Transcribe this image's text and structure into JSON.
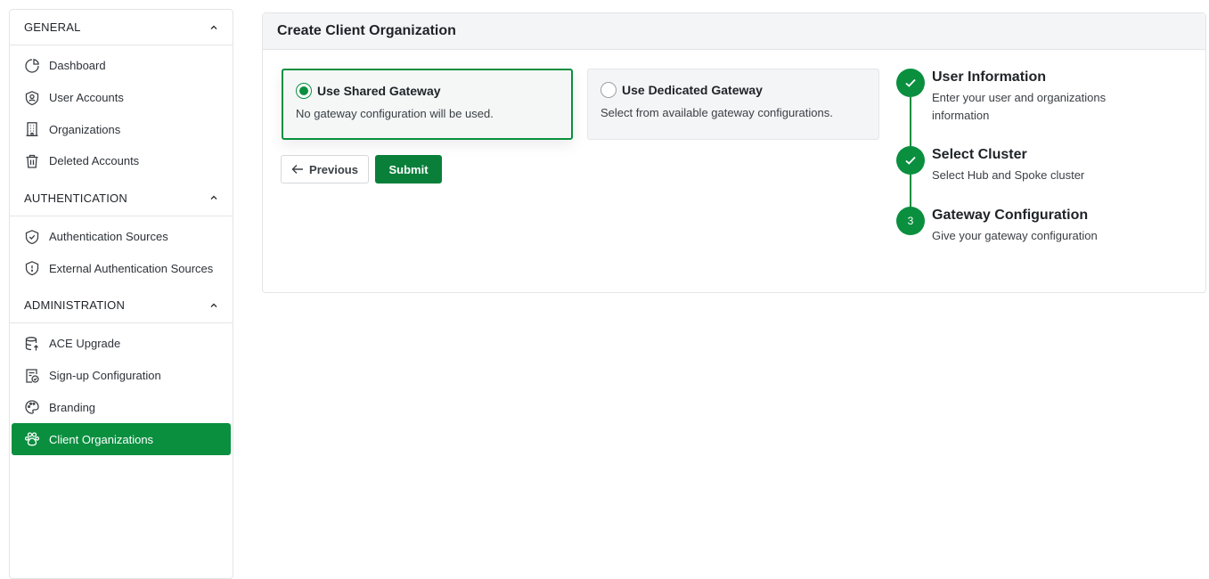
{
  "sidebar": {
    "sections": [
      {
        "title": "GENERAL",
        "items": [
          {
            "label": "Dashboard",
            "icon": "chart-pie-icon"
          },
          {
            "label": "User Accounts",
            "icon": "user-circle-icon"
          },
          {
            "label": "Organizations",
            "icon": "building-icon"
          },
          {
            "label": "Deleted Accounts",
            "icon": "trash-icon"
          }
        ]
      },
      {
        "title": "AUTHENTICATION",
        "items": [
          {
            "label": "Authentication Sources",
            "icon": "shield-check-icon"
          },
          {
            "label": "External Authentication Sources",
            "icon": "shield-alert-icon"
          }
        ]
      },
      {
        "title": "ADMINISTRATION",
        "items": [
          {
            "label": "ACE Upgrade",
            "icon": "database-upgrade-icon"
          },
          {
            "label": "Sign-up Configuration",
            "icon": "form-check-icon"
          },
          {
            "label": "Branding",
            "icon": "palette-icon"
          },
          {
            "label": "Client Organizations",
            "icon": "paw-icon",
            "active": true
          }
        ]
      }
    ]
  },
  "panel": {
    "title": "Create Client Organization",
    "options": [
      {
        "title": "Use Shared Gateway",
        "description": "No gateway configuration will be used.",
        "selected": true
      },
      {
        "title": "Use Dedicated Gateway",
        "description": "Select from available gateway configurations.",
        "selected": false
      }
    ],
    "buttons": {
      "previous": "Previous",
      "submit": "Submit"
    },
    "steps": [
      {
        "title": "User Information",
        "description": "Enter your user and organizations information",
        "status": "complete"
      },
      {
        "title": "Select Cluster",
        "description": "Select Hub and Spoke cluster",
        "status": "complete"
      },
      {
        "title": "Gateway Configuration",
        "description": "Give your gateway configuration",
        "status": "current",
        "number": "3"
      }
    ]
  },
  "colors": {
    "accent": "#0a8f3f",
    "panel_header_bg": "#f4f5f6",
    "border": "#e3e5e8"
  }
}
